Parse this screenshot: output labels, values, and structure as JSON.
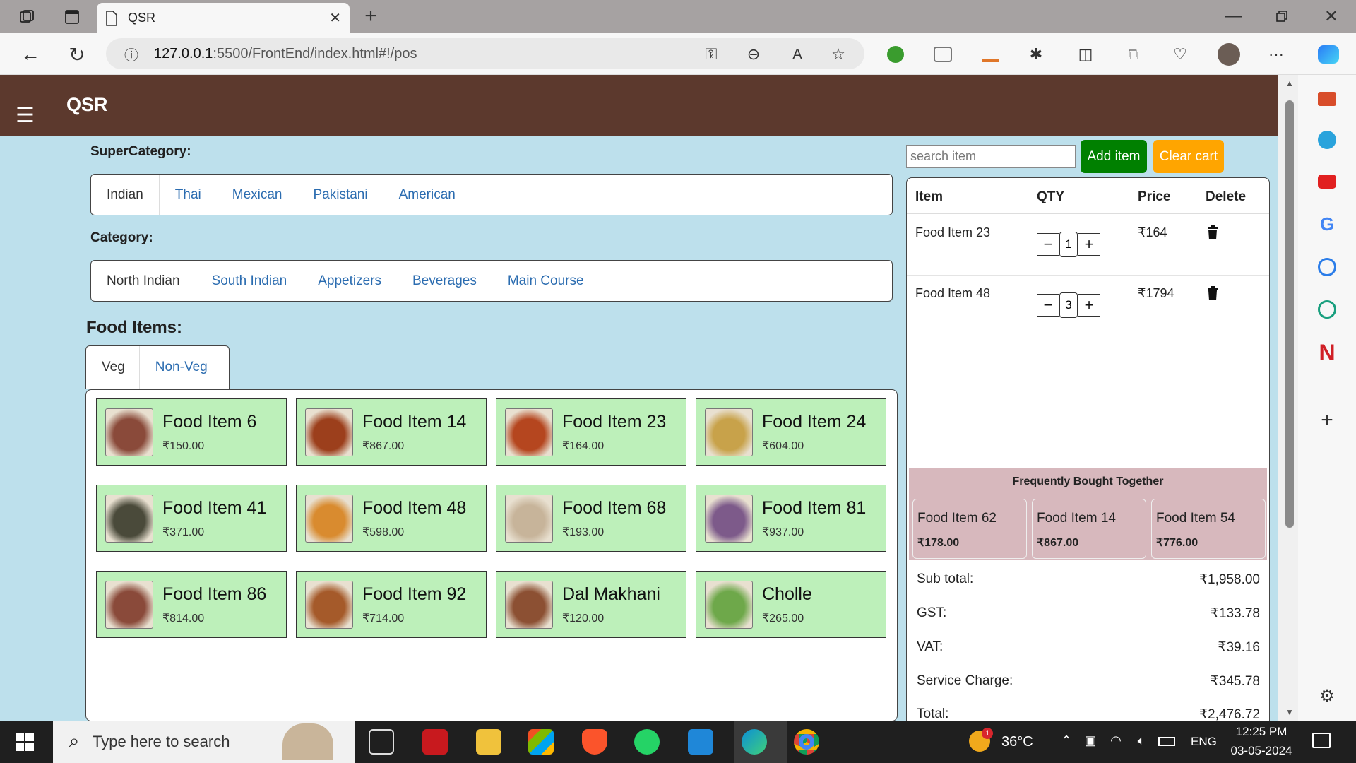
{
  "browser": {
    "tab_title": "QSR",
    "url_host": "127.0.0.1",
    "url_rest": ":5500/FrontEnd/index.html#!/pos"
  },
  "app": {
    "title": "QSR"
  },
  "supercategory": {
    "label": "SuperCategory:",
    "tabs": [
      "Indian",
      "Thai",
      "Mexican",
      "Pakistani",
      "American"
    ]
  },
  "category": {
    "label": "Category:",
    "tabs": [
      "North Indian",
      "South Indian",
      "Appetizers",
      "Beverages",
      "Main Course"
    ]
  },
  "food": {
    "label": "Food Items:",
    "tabs": [
      "Veg",
      "Non-Veg"
    ],
    "items": [
      {
        "name": "Food Item 6",
        "price": "₹150.00"
      },
      {
        "name": "Food Item 14",
        "price": "₹867.00"
      },
      {
        "name": "Food Item 23",
        "price": "₹164.00"
      },
      {
        "name": "Food Item 24",
        "price": "₹604.00"
      },
      {
        "name": "Food Item 41",
        "price": "₹371.00"
      },
      {
        "name": "Food Item 48",
        "price": "₹598.00"
      },
      {
        "name": "Food Item 68",
        "price": "₹193.00"
      },
      {
        "name": "Food Item 81",
        "price": "₹937.00"
      },
      {
        "name": "Food Item 86",
        "price": "₹814.00"
      },
      {
        "name": "Food Item 92",
        "price": "₹714.00"
      },
      {
        "name": "Dal Makhani",
        "price": "₹120.00"
      },
      {
        "name": "Cholle",
        "price": "₹265.00"
      }
    ]
  },
  "cart": {
    "search_placeholder": "search item",
    "add_label": "Add item",
    "clear_label": "Clear cart",
    "headers": [
      "Item",
      "QTY",
      "Price",
      "Delete"
    ],
    "rows": [
      {
        "item": "Food Item 23",
        "qty": "1",
        "price": "₹164"
      },
      {
        "item": "Food Item 48",
        "qty": "3",
        "price": "₹1794"
      }
    ],
    "fbt": {
      "title": "Frequently Bought Together",
      "items": [
        {
          "name": "Food Item 62",
          "price": "₹178.00"
        },
        {
          "name": "Food Item 14",
          "price": "₹867.00"
        },
        {
          "name": "Food Item 54",
          "price": "₹776.00"
        }
      ]
    },
    "totals": [
      {
        "label": "Sub total:",
        "value": "₹1,958.00"
      },
      {
        "label": "GST:",
        "value": "₹133.78"
      },
      {
        "label": "VAT:",
        "value": "₹39.16"
      },
      {
        "label": "Service Charge:",
        "value": "₹345.78"
      },
      {
        "label": "Total:",
        "value": "₹2,476.72"
      }
    ]
  },
  "taskbar": {
    "search_placeholder": "Type here to search",
    "temperature": "36°C",
    "lang": "ENG",
    "time": "12:25 PM",
    "date": "03-05-2024",
    "weather_badge": "1"
  },
  "colors": {
    "appbar": "#5c392d",
    "page_bg": "#bde0ec",
    "card_bg": "#bdf0ba",
    "add_btn": "#008000",
    "clear_btn": "#ffa500",
    "fbt_bg": "#d7b8bd"
  }
}
